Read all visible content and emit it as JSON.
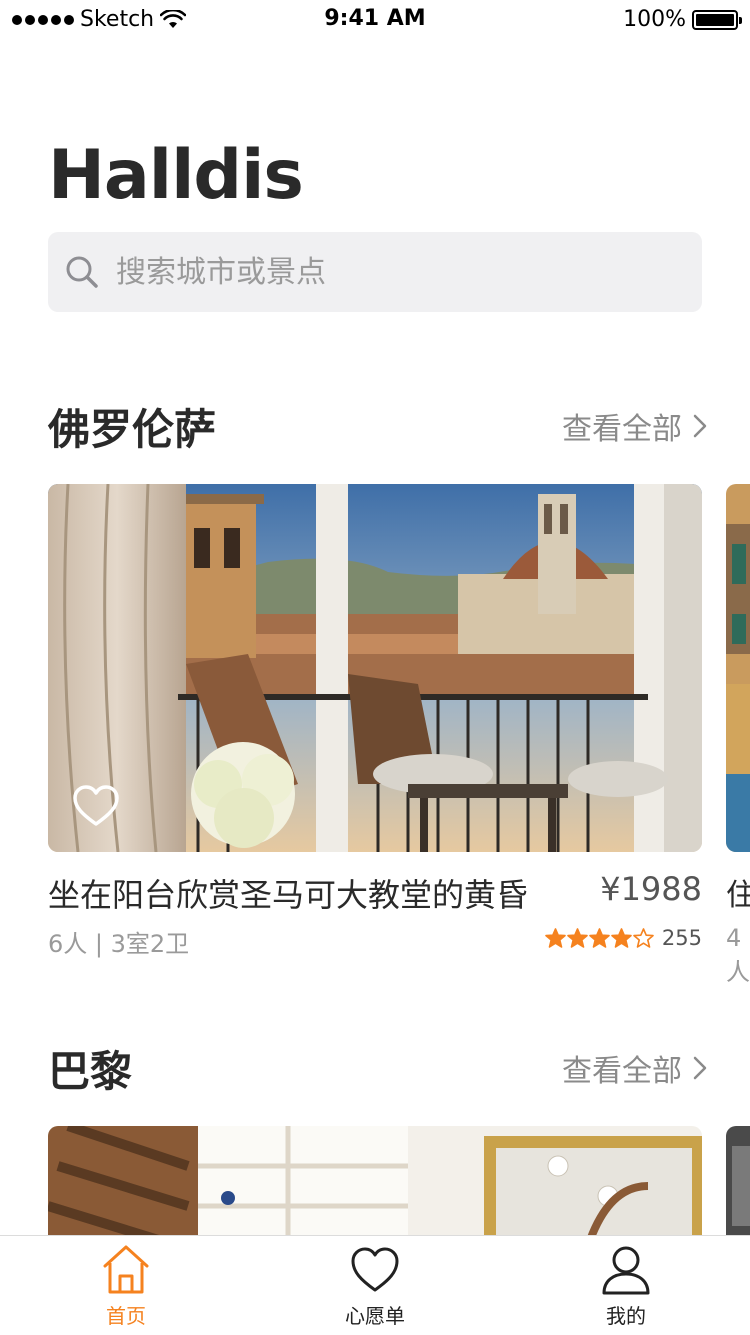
{
  "status_bar": {
    "carrier": "Sketch",
    "time": "9:41 AM",
    "battery": "100%"
  },
  "app": {
    "title": "Halldis"
  },
  "search": {
    "placeholder": "搜索城市或景点",
    "value": ""
  },
  "sections": [
    {
      "title": "佛罗伦萨",
      "see_all": "查看全部",
      "card": {
        "title": "坐在阳台欣赏圣马可大教堂的黄昏",
        "price": "¥1988",
        "meta": "6人 | 3室2卫",
        "rating": 4.5,
        "reviews": "255"
      },
      "peek": {
        "title": "住",
        "meta": "4人"
      }
    },
    {
      "title": "巴黎",
      "see_all": "查看全部"
    }
  ],
  "tabs": [
    {
      "label": "首页",
      "icon": "home-icon",
      "active": true
    },
    {
      "label": "心愿单",
      "icon": "heart-icon",
      "active": false
    },
    {
      "label": "我的",
      "icon": "person-icon",
      "active": false
    }
  ],
  "colors": {
    "accent": "#f5821f",
    "text": "#2a2a2a",
    "muted": "#9a9a9a",
    "search_bg": "#f0f0f2"
  }
}
